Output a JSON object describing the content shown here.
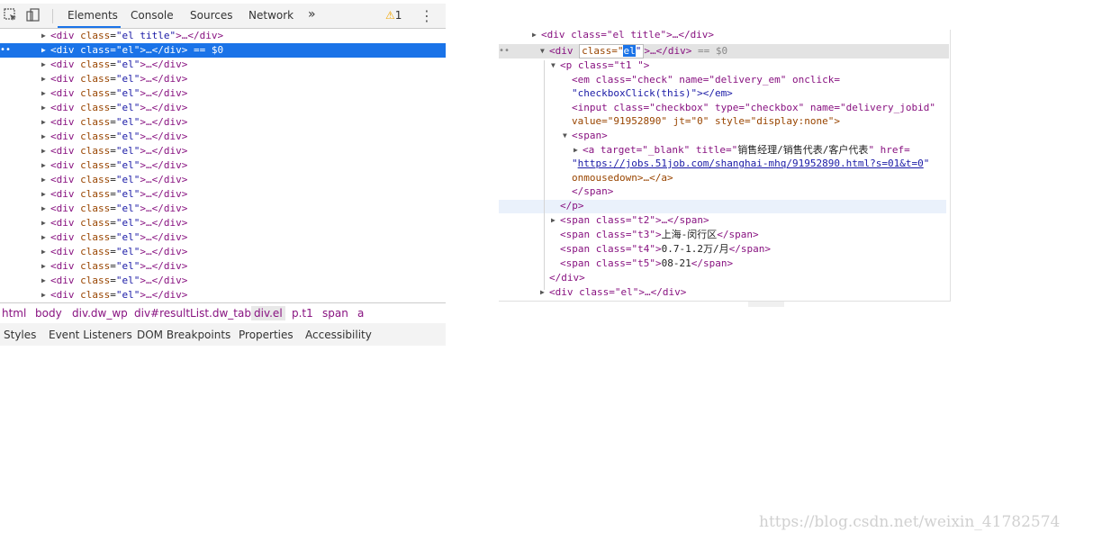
{
  "toolbar": {
    "tabs": [
      "Elements",
      "Console",
      "Sources",
      "Network"
    ],
    "more_label": "»",
    "warning_count": "1"
  },
  "tree_rows": [
    {
      "tag_open": "<div",
      "attr": "class",
      "value": "\"el title\"",
      "rest": ">…</div>"
    },
    {
      "tag_open": "<div",
      "attr": "class",
      "value": "\"el\"",
      "rest": ">…</div>",
      "suffix": "== $0"
    },
    {
      "tag_open": "<div",
      "attr": "class",
      "value": "\"el\"",
      "rest": ">…</div>"
    },
    {
      "tag_open": "<div",
      "attr": "class",
      "value": "\"el\"",
      "rest": ">…</div>"
    },
    {
      "tag_open": "<div",
      "attr": "class",
      "value": "\"el\"",
      "rest": ">…</div>"
    },
    {
      "tag_open": "<div",
      "attr": "class",
      "value": "\"el\"",
      "rest": ">…</div>"
    },
    {
      "tag_open": "<div",
      "attr": "class",
      "value": "\"el\"",
      "rest": ">…</div>"
    },
    {
      "tag_open": "<div",
      "attr": "class",
      "value": "\"el\"",
      "rest": ">…</div>"
    },
    {
      "tag_open": "<div",
      "attr": "class",
      "value": "\"el\"",
      "rest": ">…</div>"
    },
    {
      "tag_open": "<div",
      "attr": "class",
      "value": "\"el\"",
      "rest": ">…</div>"
    },
    {
      "tag_open": "<div",
      "attr": "class",
      "value": "\"el\"",
      "rest": ">…</div>"
    },
    {
      "tag_open": "<div",
      "attr": "class",
      "value": "\"el\"",
      "rest": ">…</div>"
    },
    {
      "tag_open": "<div",
      "attr": "class",
      "value": "\"el\"",
      "rest": ">…</div>"
    },
    {
      "tag_open": "<div",
      "attr": "class",
      "value": "\"el\"",
      "rest": ">…</div>"
    },
    {
      "tag_open": "<div",
      "attr": "class",
      "value": "\"el\"",
      "rest": ">…</div>"
    },
    {
      "tag_open": "<div",
      "attr": "class",
      "value": "\"el\"",
      "rest": ">…</div>"
    },
    {
      "tag_open": "<div",
      "attr": "class",
      "value": "\"el\"",
      "rest": ">…</div>"
    },
    {
      "tag_open": "<div",
      "attr": "class",
      "value": "\"el\"",
      "rest": ">…</div>"
    },
    {
      "tag_open": "<div",
      "attr": "class",
      "value": "\"el\"",
      "rest": ">…</div>"
    }
  ],
  "breadcrumbs": [
    "html",
    "body",
    "div.dw_wp",
    "div#resultList.dw_table",
    "div.el",
    "p.t1",
    "span",
    "a"
  ],
  "subtabs": [
    "Styles",
    "Event Listeners",
    "DOM Breakpoints",
    "Properties",
    "Accessibility"
  ],
  "right": {
    "top_partial": "<div class=\"el title\">…</div>",
    "sel_open": "<div",
    "sel_attr": "class=\"",
    "sel_value": "el",
    "sel_close": "\"",
    "sel_rest": ">…</div>",
    "sel_suffix": "== $0",
    "p_line": "<p class=\"t1 \">",
    "em_line1": "<em class=\"check\" name=\"delivery_em\" onclick=",
    "em_line2": "\"checkboxClick(this)\"></em>",
    "input_line1": "<input class=\"checkbox\" type=\"checkbox\" name=\"delivery_jobid\"",
    "input_line2": "value=\"91952890\" jt=\"0\" style=\"display:none\">",
    "span_open": "<span>",
    "a_line1_pre": "<a target=\"_blank\" title=\"",
    "a_title": "销售经理/销售代表/客户代表",
    "a_line1_post": "\" href=",
    "a_href": "https://jobs.51job.com/shanghai-mhq/91952890.html?s=01&t=0",
    "a_line3": "onmousedown>…</a>",
    "span_close": "</span>",
    "p_close": "</p>",
    "t2_line": "<span class=\"t2\">…</span>",
    "t3_pre": "<span class=\"t3\">",
    "t3_text": "上海-闵行区",
    "t4_pre": "<span class=\"t4\">",
    "t4_text": "0.7-1.2万/月",
    "t5_pre": "<span class=\"t5\">",
    "t5_text": "08-21",
    "close_span": "</span>",
    "div_close": "</div>",
    "next_div": "<div class=\"el\">…</div>"
  },
  "watermark": "https://blog.csdn.net/weixin_41782574"
}
